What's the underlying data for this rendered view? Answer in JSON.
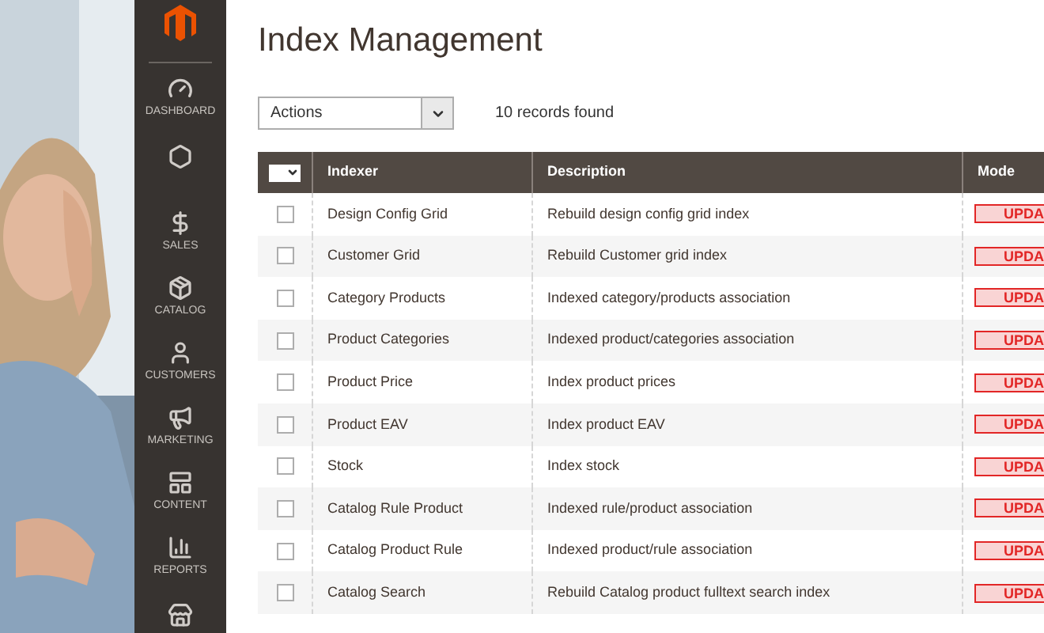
{
  "sidebar": {
    "items": [
      {
        "label": "DASHBOARD"
      },
      {
        "kind": "icon_only"
      },
      {
        "label": "SALES"
      },
      {
        "label": "CATALOG"
      },
      {
        "label": "CUSTOMERS"
      },
      {
        "label": "MARKETING"
      },
      {
        "label": "CONTENT"
      },
      {
        "label": "REPORTS"
      },
      {
        "kind": "icon_only"
      }
    ]
  },
  "page_title": "Index Management",
  "actions": {
    "value": "Actions"
  },
  "records": "10 records found",
  "table": {
    "select_all": {
      "checked": false
    },
    "columns": [
      "Indexer",
      "Description",
      "Mode"
    ],
    "rows": [
      {
        "indexer": "Design Config Grid",
        "description": "Rebuild design config grid index",
        "mode": "UPDA",
        "checked": false
      },
      {
        "indexer": "Customer Grid",
        "description": "Rebuild Customer grid index",
        "mode": "UPDA",
        "checked": false
      },
      {
        "indexer": "Category Products",
        "description": "Indexed category/products association",
        "mode": "UPDA",
        "checked": false
      },
      {
        "indexer": "Product Categories",
        "description": "Indexed product/categories association",
        "mode": "UPDA",
        "checked": false
      },
      {
        "indexer": "Product Price",
        "description": "Index product prices",
        "mode": "UPDA",
        "checked": false
      },
      {
        "indexer": "Product EAV",
        "description": "Index product EAV",
        "mode": "UPDA",
        "checked": false
      },
      {
        "indexer": "Stock",
        "description": "Index stock",
        "mode": "UPDA",
        "checked": false
      },
      {
        "indexer": "Catalog Rule Product",
        "description": "Indexed rule/product association",
        "mode": "UPDA",
        "checked": false
      },
      {
        "indexer": "Catalog Product Rule",
        "description": "Indexed product/rule association",
        "mode": "UPDA",
        "checked": false
      },
      {
        "indexer": "Catalog Search",
        "description": "Rebuild Catalog product fulltext search index",
        "mode": "UPDA",
        "checked": false
      }
    ]
  }
}
